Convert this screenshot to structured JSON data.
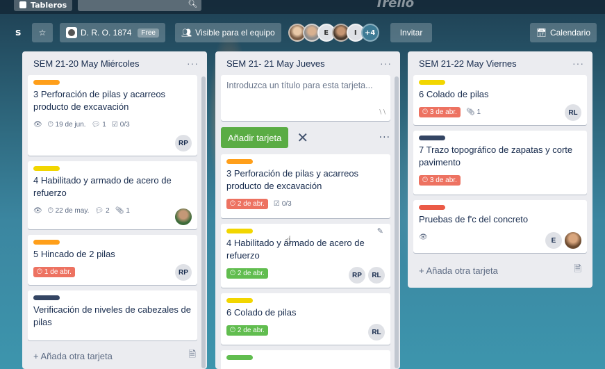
{
  "topbar": {
    "boards_label": "Tableros",
    "logo_text": "Trello"
  },
  "board_header": {
    "cut_text": "s",
    "org_name": "D. R. O. 1874",
    "org_badge": "Free",
    "visibility": "Visible para el equipo",
    "avatars": [
      {
        "type": "photo",
        "label": ""
      },
      {
        "type": "photo",
        "label": ""
      },
      {
        "type": "letter",
        "label": "E"
      },
      {
        "type": "photo",
        "label": ""
      },
      {
        "type": "letter",
        "label": "I"
      }
    ],
    "more_members": "+4",
    "invite_label": "Invitar",
    "calendar_label": "Calendario"
  },
  "colors": {
    "orange": "#ff9f1a",
    "yellow": "#f2d600",
    "dark": "#344563",
    "red": "#eb5a46",
    "green": "#61bd4f",
    "add_button": "#5aac44"
  },
  "lists": [
    {
      "title": "SEM 21-20 May Miércoles",
      "cards": [
        {
          "label": "orange",
          "title": "3 Perforación de pilas y acarreos producto de excavación",
          "watch": true,
          "due": "19 de jun.",
          "due_style": "plain",
          "comments": "1",
          "checklist": "0/3",
          "members": [
            "RP"
          ]
        },
        {
          "label": "yellow",
          "title": "4 Habilitado y armado de acero de refuerzo",
          "watch": true,
          "due": "22 de may.",
          "due_style": "plain",
          "comments": "2",
          "attachments": "1",
          "members": [
            "photo"
          ]
        },
        {
          "label": "orange",
          "title": "5 Hincado de 2 pilas",
          "due": "1 de abr.",
          "due_style": "red",
          "members": [
            "RP"
          ]
        },
        {
          "label": "dark",
          "title": "Verificación de niveles de cabezales de pilas"
        }
      ],
      "add_label": "+ Añada otra tarjeta"
    },
    {
      "title": "SEM 21- 21 May Jueves",
      "composer_placeholder": "Introduzca un título para esta tarjeta...",
      "add_button_label": "Añadir tarjeta",
      "cards": [
        {
          "label": "orange",
          "title": "3 Perforación de pilas y acarreos producto de excavación",
          "due": "2 de abr.",
          "due_style": "red",
          "checklist": "0/3"
        },
        {
          "label": "yellow",
          "title": "4 Habilitado y armado de acero de refuerzo",
          "due": "2 de abr.",
          "due_style": "green",
          "members": [
            "RP",
            "RL"
          ]
        },
        {
          "label": "yellow",
          "title": "6 Colado de pilas",
          "due": "2 de abr.",
          "due_style": "green",
          "members": [
            "RL"
          ]
        }
      ]
    },
    {
      "title": "SEM 21-22 May Viernes",
      "cards": [
        {
          "label": "yellow",
          "title": "6 Colado de pilas",
          "due": "3 de abr.",
          "due_style": "red",
          "attachments": "1",
          "members": [
            "RL"
          ]
        },
        {
          "label": "dark",
          "title": "7 Trazo topográfico de zapatas y corte pavimento",
          "due": "3 de abr.",
          "due_style": "red"
        },
        {
          "label": "red",
          "title": "Pruebas de f'c del concreto",
          "watch": true,
          "members": [
            "E",
            "photo"
          ]
        }
      ],
      "add_label": "+ Añada otra tarjeta"
    }
  ]
}
